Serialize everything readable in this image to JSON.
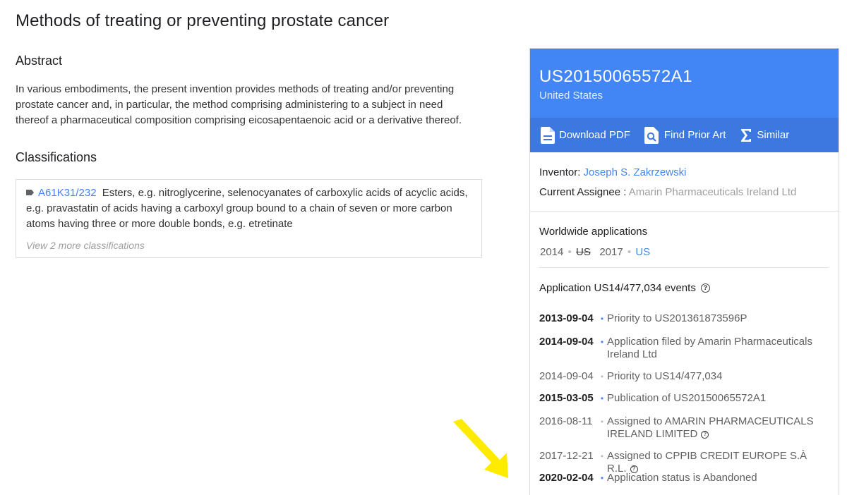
{
  "title": "Methods of treating or preventing prostate cancer",
  "abstract": {
    "heading": "Abstract",
    "text": "In various embodiments, the present invention provides methods of treating and/or preventing prostate cancer and, in particular, the method comprising administering to a subject in need thereof a pharmaceutical composition comprising eicosapentaenoic acid or a derivative thereof."
  },
  "classifications": {
    "heading": "Classifications",
    "code": "A61K31/232",
    "description": "Esters, e.g. nitroglycerine, selenocyanates of carboxylic acids of acyclic acids, e.g. pravastatin of acids having a carboxyl group bound to a chain of seven or more carbon atoms having three or more double bonds, e.g. etretinate",
    "view_more": "View 2 more classifications"
  },
  "panel": {
    "pub_number": "US20150065572A1",
    "country": "United States",
    "actions": {
      "download": "Download PDF",
      "prior_art": "Find Prior Art",
      "similar": "Similar"
    },
    "inventor_label": "Inventor:",
    "inventor": "Joseph S. Zakrzewski",
    "assignee_label": "Current Assignee :",
    "assignee": "Amarin Pharmaceuticals Ireland Ltd",
    "worldwide": {
      "heading": "Worldwide applications",
      "y1": "2014",
      "c1": "US",
      "y2": "2017",
      "c2": "US"
    },
    "events_heading": "Application US14/477,034 events",
    "events": [
      {
        "date": "2013-09-04",
        "text": "Priority to US201361873596P"
      },
      {
        "date": "2014-09-04",
        "text": "Application filed by Amarin Pharmaceuticals Ireland Ltd"
      },
      {
        "date": "2014-09-04",
        "text": "Priority to US14/477,034"
      },
      {
        "date": "2015-03-05",
        "text": "Publication of US20150065572A1"
      },
      {
        "date": "2016-08-11",
        "text": "Assigned to AMARIN PHARMACEUTICALS IRELAND LIMITED"
      },
      {
        "date": "2017-12-21",
        "text": "Assigned to CPPIB CREDIT EUROPE S.À R.L."
      },
      {
        "date": "2020-02-04",
        "text": "Application status is Abandoned"
      }
    ]
  },
  "colors": {
    "accent": "#4285f4",
    "arrow": "#ffeb00"
  }
}
